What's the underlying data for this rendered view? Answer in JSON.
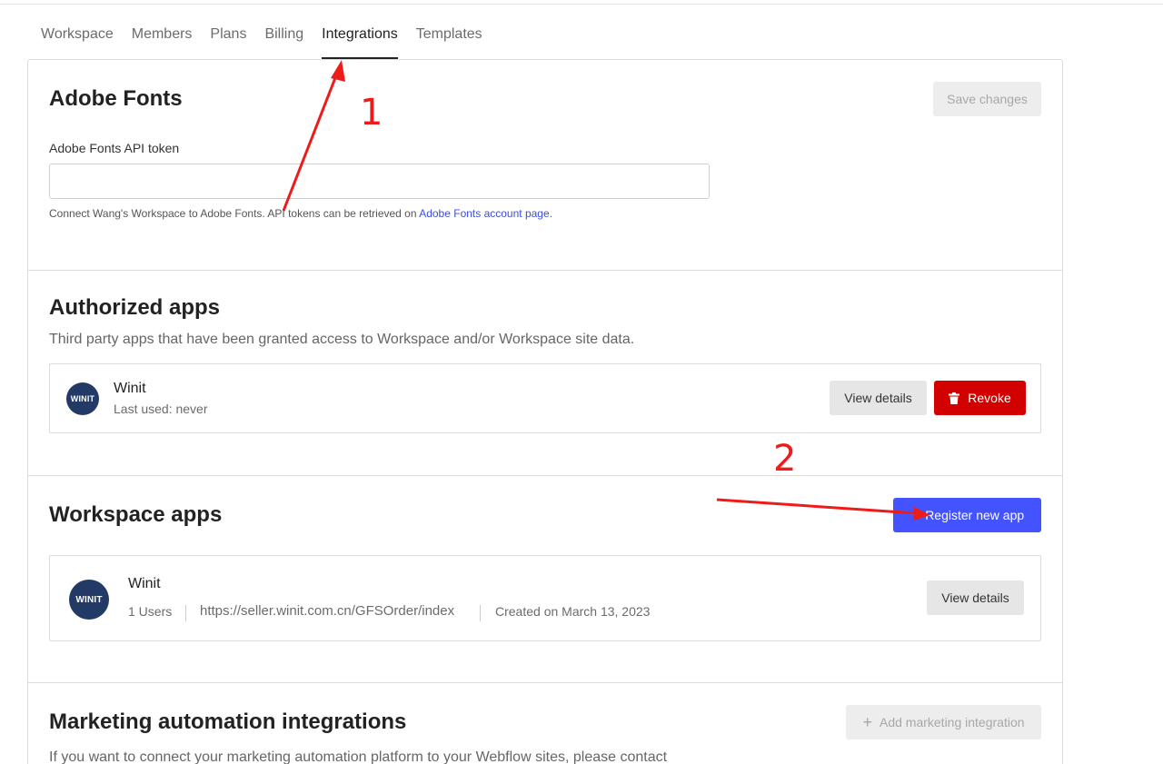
{
  "tabs": [
    {
      "label": "Workspace",
      "active": false
    },
    {
      "label": "Members",
      "active": false
    },
    {
      "label": "Plans",
      "active": false
    },
    {
      "label": "Billing",
      "active": false
    },
    {
      "label": "Integrations",
      "active": true
    },
    {
      "label": "Templates",
      "active": false
    }
  ],
  "adobe_fonts": {
    "title": "Adobe Fonts",
    "save_label": "Save changes",
    "token_label": "Adobe Fonts API token",
    "token_value": "",
    "help_text": "Connect Wang's Workspace to Adobe Fonts. API tokens can be retrieved on ",
    "help_link": "Adobe Fonts account page",
    "help_suffix": "."
  },
  "authorized_apps": {
    "title": "Authorized apps",
    "subtitle": "Third party apps that have been granted access to Workspace and/or Workspace site data.",
    "app": {
      "name": "Winit",
      "last_used": "Last used: never",
      "logo_text": "WINIT",
      "view_label": "View details",
      "revoke_label": "Revoke"
    }
  },
  "workspace_apps": {
    "title": "Workspace apps",
    "register_label": "Register new app",
    "app": {
      "name": "Winit",
      "users": "1 Users",
      "url": "https://seller.winit.com.cn/GFSOrder/index",
      "created": "Created on March 13, 2023",
      "logo_text": "WINIT",
      "view_label": "View details"
    }
  },
  "marketing": {
    "title": "Marketing automation integrations",
    "add_label": "Add marketing integration",
    "subtitle": "If you want to connect your marketing automation platform to your Webflow sites, please contact"
  },
  "annotations": {
    "one": "1",
    "two": "2"
  },
  "colors": {
    "accent_blue": "#4353ff",
    "danger_red": "#d30000",
    "annotation_red": "#ee1b1b",
    "logo_navy": "#233a66"
  },
  "icons": {
    "revoke": "trash-icon",
    "register": "plus-icon",
    "add_marketing": "plus-icon"
  }
}
